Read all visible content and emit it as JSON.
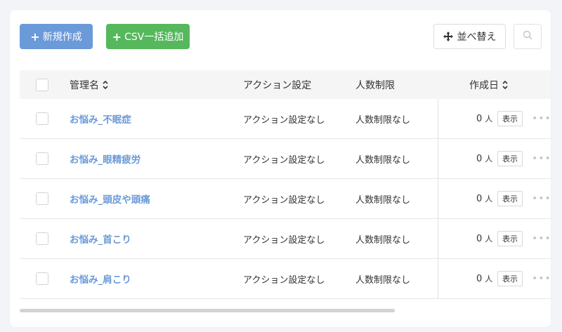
{
  "toolbar": {
    "new_label": "新規作成",
    "csv_label": "CSV一括追加",
    "sort_label": "並べ替え"
  },
  "table": {
    "headers": {
      "name": "管理名",
      "action": "アクション設定",
      "limit": "人数制限",
      "created": "作成日"
    },
    "rows": [
      {
        "name": "お悩み_不眠症",
        "action": "アクション設定なし",
        "limit": "人数制限なし",
        "count": "0",
        "unit": "人",
        "show": "表示"
      },
      {
        "name": "お悩み_眼精疲労",
        "action": "アクション設定なし",
        "limit": "人数制限なし",
        "count": "0",
        "unit": "人",
        "show": "表示"
      },
      {
        "name": "お悩み_頭皮や頭痛",
        "action": "アクション設定なし",
        "limit": "人数制限なし",
        "count": "0",
        "unit": "人",
        "show": "表示"
      },
      {
        "name": "お悩み_首こり",
        "action": "アクション設定なし",
        "limit": "人数制限なし",
        "count": "0",
        "unit": "人",
        "show": "表示"
      },
      {
        "name": "お悩み_肩こり",
        "action": "アクション設定なし",
        "limit": "人数制限なし",
        "count": "0",
        "unit": "人",
        "show": "表示"
      }
    ]
  },
  "icons": {
    "plus": "plus-icon",
    "move": "move-icon",
    "search": "search-icon",
    "sort": "sort-caret-icon",
    "more": "more-icon"
  },
  "colors": {
    "primary": "#6b9ad9",
    "success": "#56b85c",
    "link": "#6a9ad6"
  }
}
